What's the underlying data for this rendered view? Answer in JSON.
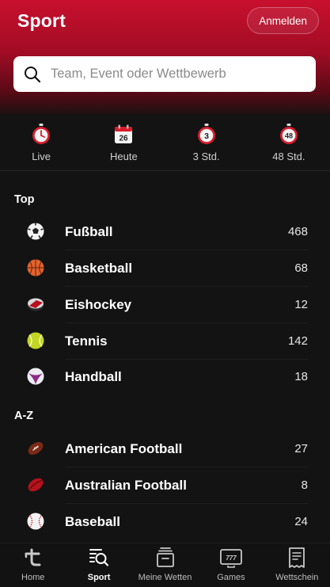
{
  "header": {
    "title": "Sport",
    "login_label": "Anmelden",
    "brand_color": "#c8102e"
  },
  "search": {
    "placeholder": "Team, Event oder Wettbewerb",
    "icon": "search-icon"
  },
  "filters": [
    {
      "label": "Live",
      "icon": "stopwatch-icon"
    },
    {
      "label": "Heute",
      "icon": "calendar-icon",
      "badge": "26"
    },
    {
      "label": "3 Std.",
      "icon": "timer-3-icon",
      "badge": "3"
    },
    {
      "label": "48 Std.",
      "icon": "timer-48-icon",
      "badge": "48"
    }
  ],
  "sections": {
    "top": {
      "title": "Top",
      "items": [
        {
          "name": "Fußball",
          "count": "468",
          "icon": "soccer-ball-icon"
        },
        {
          "name": "Basketball",
          "count": "68",
          "icon": "basketball-icon"
        },
        {
          "name": "Eishockey",
          "count": "12",
          "icon": "hockey-puck-icon"
        },
        {
          "name": "Tennis",
          "count": "142",
          "icon": "tennis-ball-icon"
        },
        {
          "name": "Handball",
          "count": "18",
          "icon": "handball-icon"
        }
      ]
    },
    "az": {
      "title": "A-Z",
      "items": [
        {
          "name": "American Football",
          "count": "27",
          "icon": "american-football-icon"
        },
        {
          "name": "Australian Football",
          "count": "8",
          "icon": "australian-football-icon"
        },
        {
          "name": "Baseball",
          "count": "24",
          "icon": "baseball-icon"
        }
      ]
    }
  },
  "bottom_nav": [
    {
      "label": "Home",
      "icon": "home-logo-icon",
      "active": false
    },
    {
      "label": "Sport",
      "icon": "sport-search-icon",
      "active": true
    },
    {
      "label": "Meine Wetten",
      "icon": "my-bets-icon",
      "active": false
    },
    {
      "label": "Games",
      "icon": "games-icon",
      "active": false
    },
    {
      "label": "Wettschein",
      "icon": "betslip-icon",
      "active": false
    }
  ]
}
